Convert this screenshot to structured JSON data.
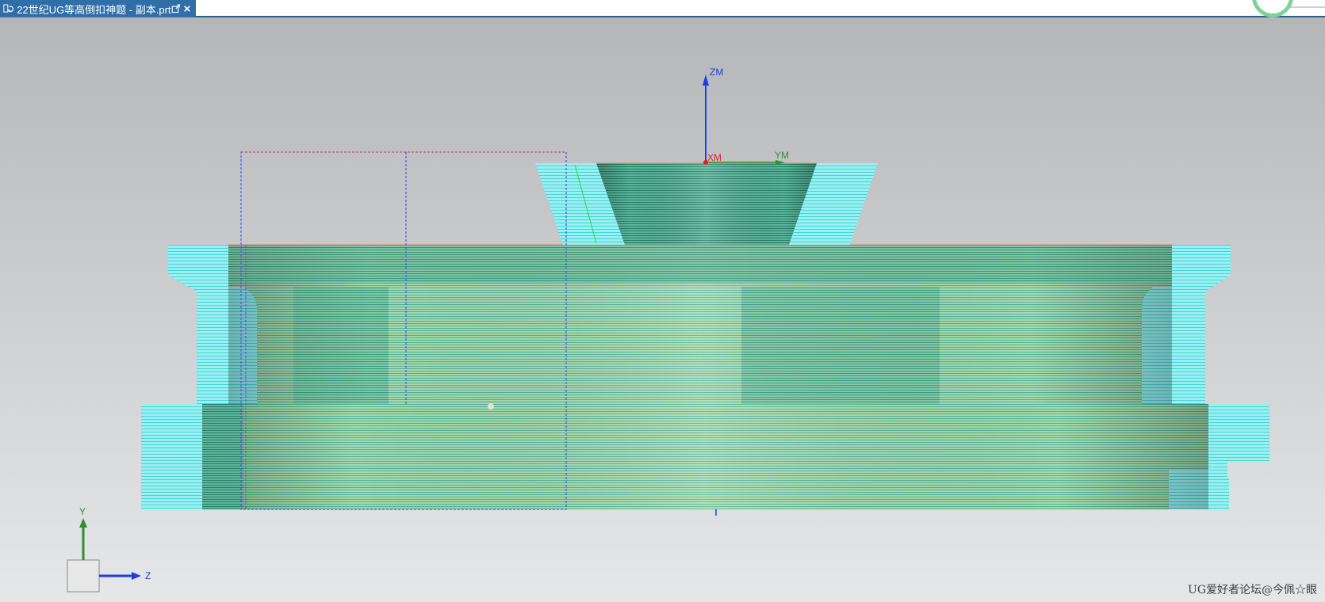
{
  "tab": {
    "title": "22世纪UG等高倒扣神题 - 副本.prt",
    "icons": {
      "document": "part-file-icon",
      "popout": "popout-window-icon",
      "close": "close-icon"
    },
    "active_color": "#2f6ea6"
  },
  "viewport": {
    "background_top": "#b4b6b8",
    "background_bottom": "#e6e7e8",
    "wcs": {
      "z_label": "ZM",
      "x_label": "XM",
      "y_label": "YM"
    },
    "triad": {
      "y_label": "Y",
      "z_label": "Z"
    },
    "colors": {
      "toolpath_cyan": "#7fe8ea",
      "part_green": "#9ed9a8",
      "part_dark": "#3c9a86",
      "blank_box": "#5058e0",
      "blank_top": "#e05050",
      "axis_blue": "#1c3fe0",
      "axis_green": "#2f8f2f",
      "axis_red": "#e02020"
    }
  },
  "watermark": "UG爱好者论坛@今佩☆眼"
}
